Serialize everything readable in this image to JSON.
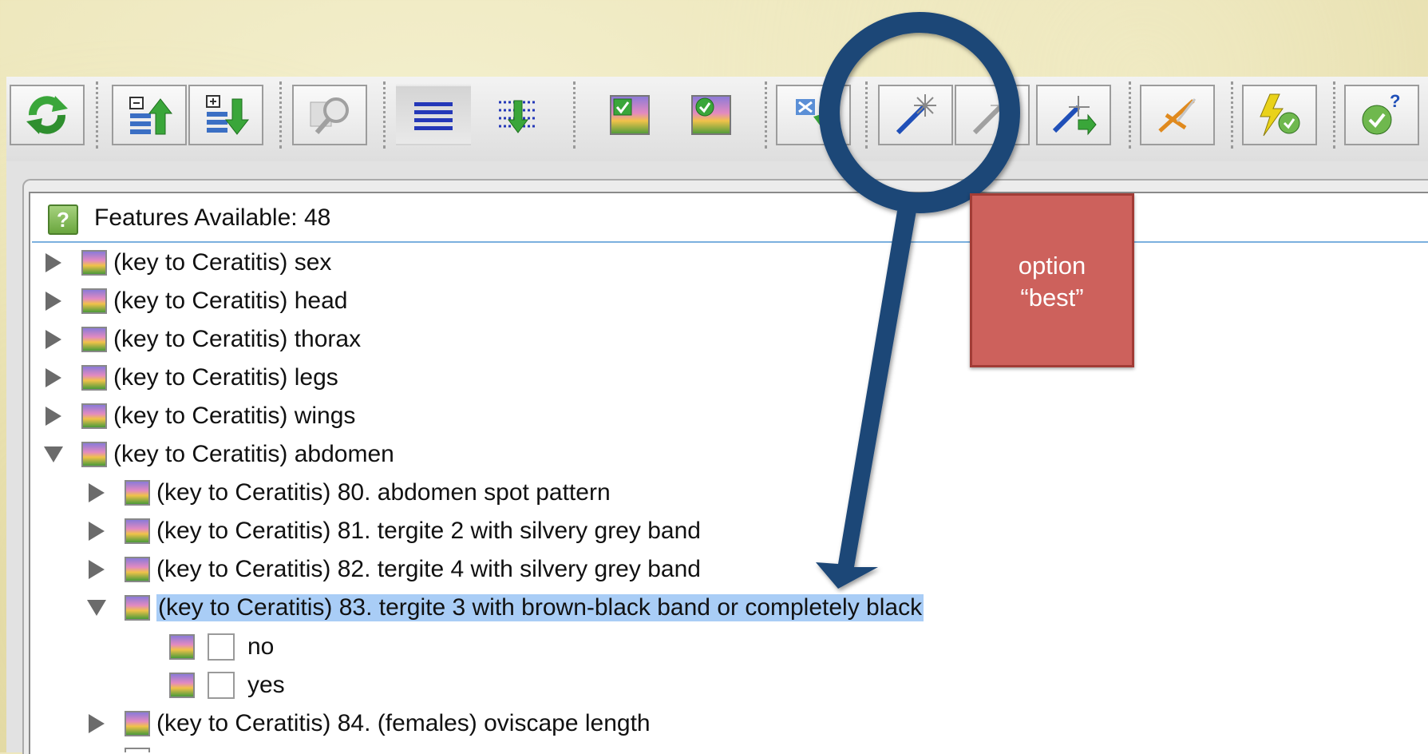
{
  "header": {
    "title": "Features Available: 48",
    "help_icon": "?"
  },
  "toolbar": {
    "buttons": [
      {
        "name": "refresh-icon"
      },
      {
        "name": "move-up-icon"
      },
      {
        "name": "move-down-icon"
      },
      {
        "name": "find-icon"
      },
      {
        "name": "list-view-icon"
      },
      {
        "name": "expand-all-icon"
      },
      {
        "name": "image-check-icon"
      },
      {
        "name": "image-ok-icon"
      },
      {
        "name": "delete-icon"
      },
      {
        "name": "magic-wand-icon"
      },
      {
        "name": "magic-wand-disabled-icon"
      },
      {
        "name": "magic-wand-forward-icon"
      },
      {
        "name": "scissors-icon"
      },
      {
        "name": "lightning-check-icon"
      },
      {
        "name": "check-help-icon"
      }
    ]
  },
  "tree": [
    {
      "label": "(key to Ceratitis) sex",
      "level": 0,
      "expanded": false
    },
    {
      "label": "(key to Ceratitis) head",
      "level": 0,
      "expanded": false
    },
    {
      "label": "(key to Ceratitis) thorax",
      "level": 0,
      "expanded": false
    },
    {
      "label": "(key to Ceratitis) legs",
      "level": 0,
      "expanded": false
    },
    {
      "label": "(key to Ceratitis) wings",
      "level": 0,
      "expanded": false
    },
    {
      "label": "(key to Ceratitis) abdomen",
      "level": 0,
      "expanded": true
    },
    {
      "label": "(key to Ceratitis) 80. abdomen spot pattern",
      "level": 1,
      "expanded": false
    },
    {
      "label": "(key to Ceratitis) 81. tergite 2 with silvery grey band",
      "level": 1,
      "expanded": false
    },
    {
      "label": "(key to Ceratitis) 82. tergite 4 with silvery grey band",
      "level": 1,
      "expanded": false
    },
    {
      "label": "(key to Ceratitis) 83. tergite 3 with brown-black band or completely black",
      "level": 1,
      "expanded": true,
      "selected": true
    },
    {
      "label": "no",
      "level": 2,
      "checked": false
    },
    {
      "label": "yes",
      "level": 2,
      "checked": false
    },
    {
      "label": "(key to Ceratitis) 84. (females) oviscape length",
      "level": 1,
      "expanded": false
    }
  ],
  "callout": {
    "line1": "option",
    "line2": "“best”"
  },
  "colors": {
    "selection": "#a9cdf6",
    "callout": "#cd615c",
    "magnifier": "#1d4777"
  }
}
